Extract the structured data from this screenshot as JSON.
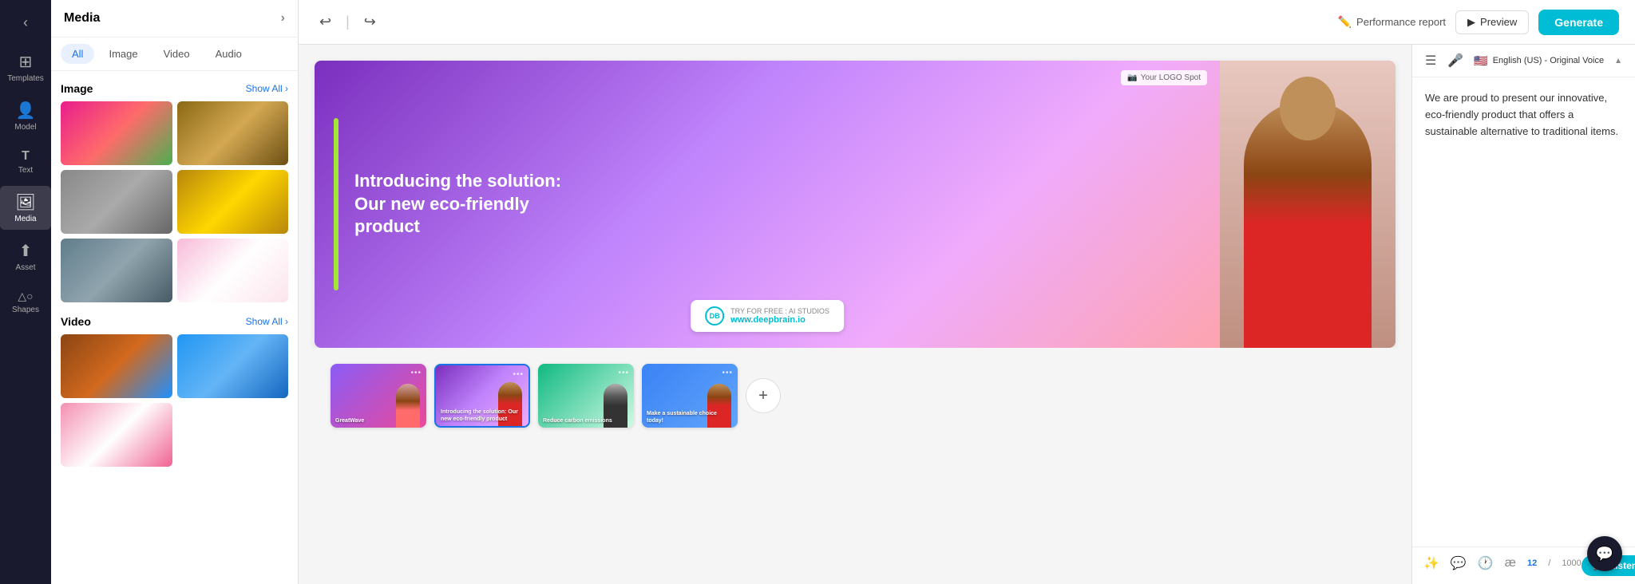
{
  "app": {
    "title": "Media"
  },
  "sidebar": {
    "items": [
      {
        "id": "templates",
        "label": "Templates",
        "icon": "⊞"
      },
      {
        "id": "model",
        "label": "Model",
        "icon": "👤"
      },
      {
        "id": "text",
        "label": "Text",
        "icon": "T"
      },
      {
        "id": "media",
        "label": "Media",
        "icon": "🖼"
      },
      {
        "id": "asset",
        "label": "Asset",
        "icon": "↑"
      },
      {
        "id": "shapes",
        "label": "Shapes",
        "icon": "△○"
      }
    ]
  },
  "media_panel": {
    "title": "Media",
    "tabs": [
      "All",
      "Image",
      "Video",
      "Audio"
    ],
    "active_tab": "All",
    "image_section": {
      "title": "Image",
      "show_all": "Show All ›"
    },
    "video_section": {
      "title": "Video",
      "show_all": "Show All ›"
    }
  },
  "toolbar": {
    "undo_label": "↩",
    "redo_label": "↪",
    "performance_report": "Performance report",
    "preview_label": "Preview",
    "generate_label": "Generate"
  },
  "slide": {
    "title": "Introducing the solution: Our new eco-friendly product",
    "logo_text": "Your LOGO Spot",
    "cta_top": "TRY FOR FREE : AI STUDIOS",
    "cta_url": "www.deepbrain.io"
  },
  "thumbnails": [
    {
      "id": 1,
      "label": "GreatWave",
      "bg": "thumb-bg-1",
      "avatar": "t-av1"
    },
    {
      "id": 2,
      "label": "Introducing the solution: Our new eco-friendly product",
      "bg": "thumb-bg-2",
      "avatar": "t-av2"
    },
    {
      "id": 3,
      "label": "Reduce carbon emissions",
      "bg": "thumb-bg-3",
      "avatar": "t-av3"
    },
    {
      "id": 4,
      "label": "Make a sustainable choice today!",
      "bg": "thumb-bg-4",
      "avatar": "t-av4"
    }
  ],
  "right_panel": {
    "language": "English (US) - Original Voice",
    "chevron_up": "▲",
    "chevron_down": "▼",
    "script": "We are proud to present our innovative, eco-friendly product that offers a sustainable alternative to traditional items.",
    "char_count": "12",
    "char_separator": "/",
    "char_limit": "1000",
    "listen_label": "Listen"
  }
}
